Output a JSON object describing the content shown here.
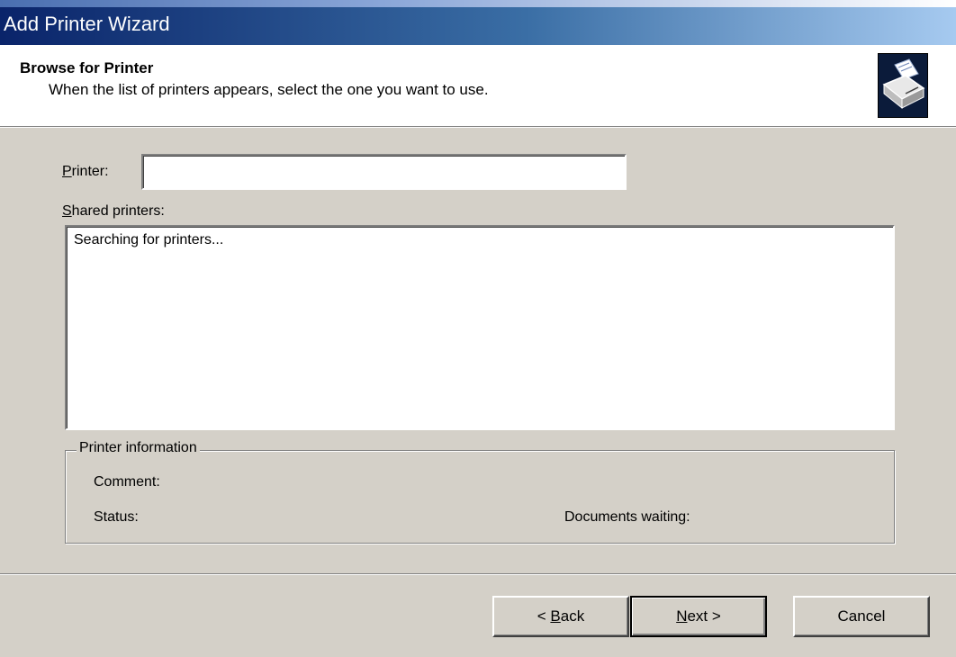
{
  "window": {
    "title": "Add Printer Wizard"
  },
  "header": {
    "title": "Browse for Printer",
    "subtitle": "When the list of printers appears, select the one you want to use.",
    "icon": "printer-icon"
  },
  "form": {
    "printer_label_accel": "P",
    "printer_label_rest": "rinter:",
    "printer_value": "",
    "shared_label_accel": "S",
    "shared_label_rest": "hared printers:",
    "shared_list_status": "Searching for printers..."
  },
  "info": {
    "group_title": "Printer information",
    "comment_label": "Comment:",
    "status_label": "Status:",
    "documents_waiting_label": "Documents waiting:"
  },
  "buttons": {
    "back_prefix": "< ",
    "back_accel": "B",
    "back_rest": "ack",
    "next_accel": "N",
    "next_rest": "ext >",
    "cancel_label": "Cancel"
  },
  "colors": {
    "dialog_face": "#d4d0c8",
    "title_bar_start": "#0a246a",
    "title_bar_end": "#a6caf0",
    "header_background": "#ffffff"
  }
}
